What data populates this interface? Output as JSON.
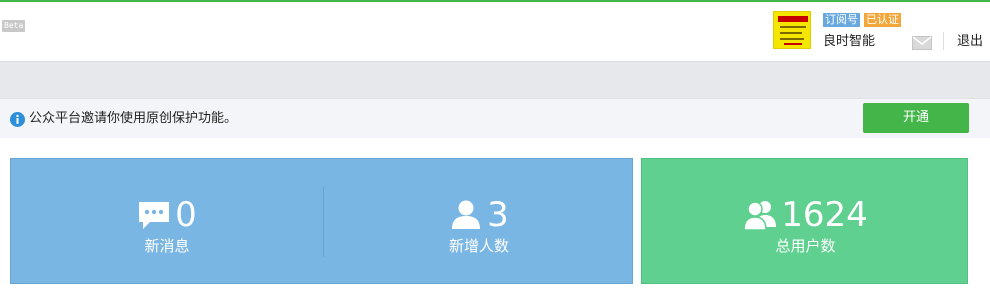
{
  "header": {
    "beta_badge": "Beta",
    "account": {
      "tag_type": "订阅号",
      "tag_verified": "已认证",
      "name": "良时智能",
      "avatar_icon": "account-logo",
      "mail_icon": "mail-icon",
      "logout_label": "退出"
    }
  },
  "notice": {
    "icon": "info-icon",
    "text": "公众平台邀请你使用原创保护功能。",
    "button_label": "开通"
  },
  "stats": [
    {
      "icon": "chat-bubble-icon",
      "value": "0",
      "label": "新消息"
    },
    {
      "icon": "user-icon",
      "value": "3",
      "label": "新增人数"
    },
    {
      "icon": "users-icon",
      "value": "1624",
      "label": "总用户数"
    }
  ],
  "colors": {
    "accent_green": "#44b549",
    "card_blue": "#7ab6e3",
    "card_green": "#5fd08f",
    "tag_blue": "#6aa8e0",
    "tag_orange": "#f3a63a"
  }
}
